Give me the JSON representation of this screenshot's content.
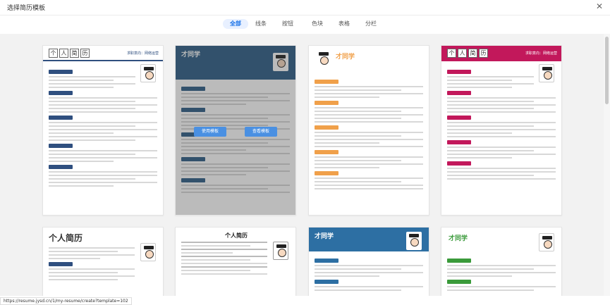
{
  "window": {
    "title": "选择简历模板",
    "close_glyph": "✕"
  },
  "tabs": [
    {
      "label": "全部",
      "active": true
    },
    {
      "label": "线条"
    },
    {
      "label": "按钮"
    },
    {
      "label": "色块"
    },
    {
      "label": "表格"
    },
    {
      "label": "分栏"
    }
  ],
  "templates": [
    {
      "title_chars": [
        "个",
        "人",
        "简",
        "历"
      ],
      "job": "求职意向：网络运营",
      "accent": "#2f4f7f"
    },
    {
      "name": "才同学",
      "accent": "#2d5d86",
      "overlay": {
        "use": "使用模板",
        "view": "查看模板"
      }
    },
    {
      "name": "才同学",
      "accent": "#f0a04a"
    },
    {
      "title_chars": [
        "个",
        "人",
        "简",
        "历"
      ],
      "job": "求职意向：网络运营",
      "accent": "#c2185b"
    },
    {
      "name": "个人简历",
      "accent": "#2f4f7f"
    },
    {
      "name": "个人简历",
      "accent": "#333333"
    },
    {
      "name": "才同学",
      "accent": "#2d6fa3"
    },
    {
      "name": "才同学",
      "accent": "#3a9a3a"
    }
  ],
  "status": {
    "url": "https://resume.jysd.cn/1/my-resume/create?template=102"
  },
  "colors": {
    "primary": "#1a73e8",
    "overlay_button": "#4a90e2"
  }
}
